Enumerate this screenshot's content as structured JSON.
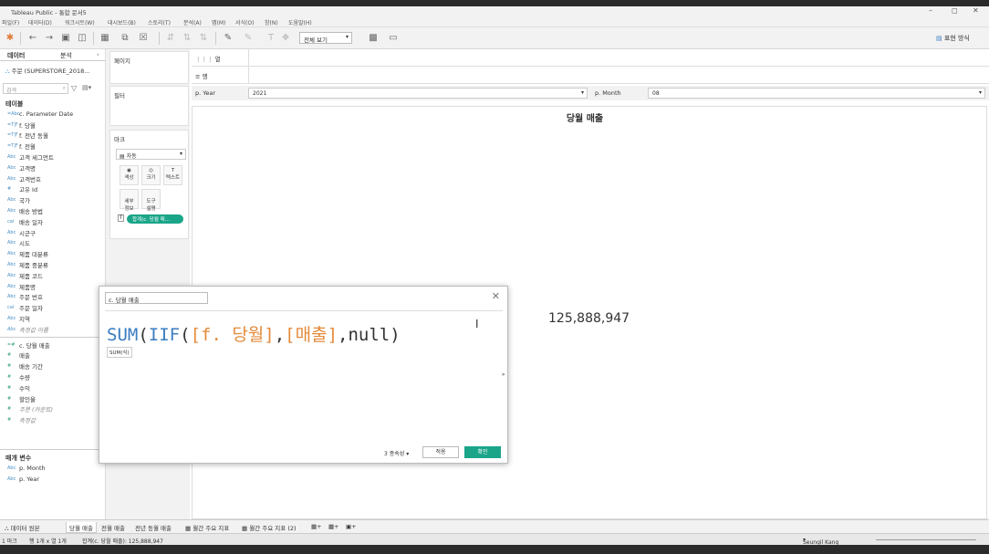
{
  "window": {
    "title": "Tableau Public - 통합 문서5"
  },
  "menu": [
    "파일(F)",
    "데이터(D)",
    "워크시트(W)",
    "대시보드(B)",
    "스토리(T)",
    "분석(A)",
    "맵(M)",
    "서식(O)",
    "창(N)",
    "도움말(H)"
  ],
  "toolbar": {
    "view_select": "전체 보기",
    "show_me": "표현 방식"
  },
  "left_tabs": {
    "data": "데이터",
    "analytics": "분석"
  },
  "datasource": "주문 (SUPERSTORE_2018...",
  "search_placeholder": "검색",
  "tables_header": "테이블",
  "fields": [
    {
      "icon": "=Abc",
      "label": "c. Parameter Date",
      "italic": false
    },
    {
      "icon": "=T|F",
      "label": "f. 당월",
      "italic": false
    },
    {
      "icon": "=T|F",
      "label": "f. 전년 동월",
      "italic": false
    },
    {
      "icon": "=T|F",
      "label": "f. 전월",
      "italic": false
    },
    {
      "icon": "Abc",
      "label": "고객 세그먼트",
      "italic": false
    },
    {
      "icon": "Abc",
      "label": "고객명",
      "italic": false
    },
    {
      "icon": "Abc",
      "label": "고객번호",
      "italic": false
    },
    {
      "icon": "#",
      "label": "고유 Id",
      "italic": false
    },
    {
      "icon": "Abc",
      "label": "국가",
      "italic": false
    },
    {
      "icon": "Abc",
      "label": "배송 방법",
      "italic": false
    },
    {
      "icon": "cal",
      "label": "배송 일자",
      "italic": false
    },
    {
      "icon": "Abc",
      "label": "시군구",
      "italic": false
    },
    {
      "icon": "Abc",
      "label": "시도",
      "italic": false
    },
    {
      "icon": "Abc",
      "label": "제품 대분류",
      "italic": false
    },
    {
      "icon": "Abc",
      "label": "제품 중분류",
      "italic": false
    },
    {
      "icon": "Abc",
      "label": "제품 코드",
      "italic": false
    },
    {
      "icon": "Abc",
      "label": "제품명",
      "italic": false
    },
    {
      "icon": "Abc",
      "label": "주문 번호",
      "italic": false
    },
    {
      "icon": "cal",
      "label": "주문 일자",
      "italic": false
    },
    {
      "icon": "Abc",
      "label": "지역",
      "italic": false
    },
    {
      "icon": "Abc",
      "label": "측정값 이름",
      "italic": true
    }
  ],
  "measures": [
    {
      "icon": "=#",
      "label": "c. 당월 매출",
      "italic": false
    },
    {
      "icon": "#",
      "label": "매출",
      "italic": false
    },
    {
      "icon": "#",
      "label": "배송 기간",
      "italic": false
    },
    {
      "icon": "#",
      "label": "수량",
      "italic": false
    },
    {
      "icon": "#",
      "label": "수익",
      "italic": false
    },
    {
      "icon": "#",
      "label": "할인율",
      "italic": false
    },
    {
      "icon": "#",
      "label": "주문 (카운트)",
      "italic": true
    },
    {
      "icon": "#",
      "label": "측정값",
      "italic": true
    }
  ],
  "params_header": "매개 변수",
  "params": [
    {
      "icon": "Abc",
      "label": "p. Month"
    },
    {
      "icon": "Abc",
      "label": "p. Year"
    }
  ],
  "cards": {
    "pages": "페이지",
    "filters": "필터",
    "marks": "마크",
    "mark_type": "자동",
    "color": "색상",
    "size": "크기",
    "text": "텍스트",
    "detail": "세부\n정보",
    "tooltip": "도구\n설명",
    "pill": "합계(c. 당월 매..."
  },
  "shelves": {
    "columns": "열",
    "rows": "행"
  },
  "filters_bar": {
    "year_label": "p. Year",
    "year_value": "2021",
    "month_label": "p. Month",
    "month_value": "08"
  },
  "view": {
    "title": "당월 매출",
    "value": "125,888,947"
  },
  "dialog": {
    "name": "c. 당월 매출",
    "formula_fn1": "SUM",
    "formula_p1": "(",
    "formula_fn2": "IIF",
    "formula_p2": "(",
    "formula_f1": "[f. 당월]",
    "formula_c1": ",",
    "formula_f2": "[매출]",
    "formula_tail": ",null)",
    "hint": "SUM(식)",
    "dependencies": "3 종속성",
    "apply": "적용",
    "ok": "확인"
  },
  "sheet_tabs": {
    "datasource": "데이터 원본",
    "tabs": [
      "당월 매출",
      "전월 매출",
      "전년 동월 매출",
      "월간 주요 지표",
      "월간 주요 지표 (2)"
    ]
  },
  "status": {
    "marks": "1 마크",
    "rows_cols": "행 1개 x 열 1개",
    "sum": "합계(c. 당월 매출): 125,888,947",
    "user": "Seungil Kang"
  },
  "colors": {
    "accent": "#1aa589",
    "fn": "#3a7cc1",
    "field": "#e48a3a"
  }
}
